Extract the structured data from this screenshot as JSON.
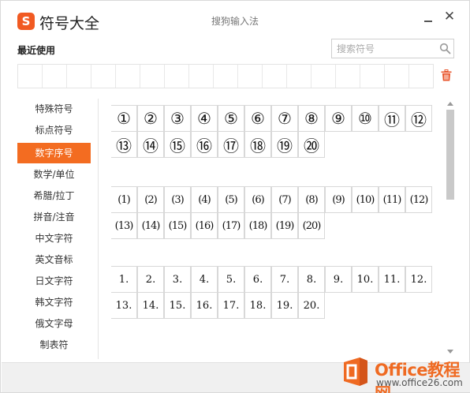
{
  "titlebar": {
    "logo_char": "S",
    "app_title": "符号大全",
    "window_title": "搜狗输入法",
    "close_glyph": "✕"
  },
  "recent": {
    "label": "最近使用",
    "cell_count": 17
  },
  "search": {
    "placeholder": "搜索符号"
  },
  "sidebar": {
    "items": [
      {
        "label": "特殊符号",
        "active": false
      },
      {
        "label": "标点符号",
        "active": false
      },
      {
        "label": "数字序号",
        "active": true
      },
      {
        "label": "数学/单位",
        "active": false
      },
      {
        "label": "希腊/拉丁",
        "active": false
      },
      {
        "label": "拼音/注音",
        "active": false
      },
      {
        "label": "中文字符",
        "active": false
      },
      {
        "label": "英文音标",
        "active": false
      },
      {
        "label": "日文字符",
        "active": false
      },
      {
        "label": "韩文字符",
        "active": false
      },
      {
        "label": "俄文字母",
        "active": false
      },
      {
        "label": "制表符",
        "active": false
      }
    ]
  },
  "symbol_groups": [
    {
      "name": "circled-numbers",
      "style": "circled",
      "symbols": [
        "①",
        "②",
        "③",
        "④",
        "⑤",
        "⑥",
        "⑦",
        "⑧",
        "⑨",
        "⑩",
        "⑪",
        "⑫",
        "⑬",
        "⑭",
        "⑮",
        "⑯",
        "⑰",
        "⑱",
        "⑲",
        "⑳"
      ]
    },
    {
      "name": "parenthesized-numbers",
      "style": "paren",
      "symbols": [
        "(1)",
        "(2)",
        "(3)",
        "(4)",
        "(5)",
        "(6)",
        "(7)",
        "(8)",
        "(9)",
        "(10)",
        "(11)",
        "(12)",
        "(13)",
        "(14)",
        "(15)",
        "(16)",
        "(17)",
        "(18)",
        "(19)",
        "(20)"
      ]
    },
    {
      "name": "dotted-numbers",
      "style": "dot",
      "symbols": [
        "1.",
        "2.",
        "3.",
        "4.",
        "5.",
        "6.",
        "7.",
        "8.",
        "9.",
        "10.",
        "11.",
        "12.",
        "13.",
        "14.",
        "15.",
        "16.",
        "17.",
        "18.",
        "19.",
        "20."
      ]
    }
  ],
  "watermark": {
    "brand": "Office教程网",
    "url": "www.office26.com"
  },
  "colors": {
    "accent": "#f36c21",
    "logo": "#f15a22",
    "trash": "#e8542a",
    "watermark_orange": "#ef6a22"
  },
  "icons": {
    "search": "search-icon",
    "trash": "trash-icon",
    "minimize": "minimize-icon",
    "close": "close-icon"
  }
}
